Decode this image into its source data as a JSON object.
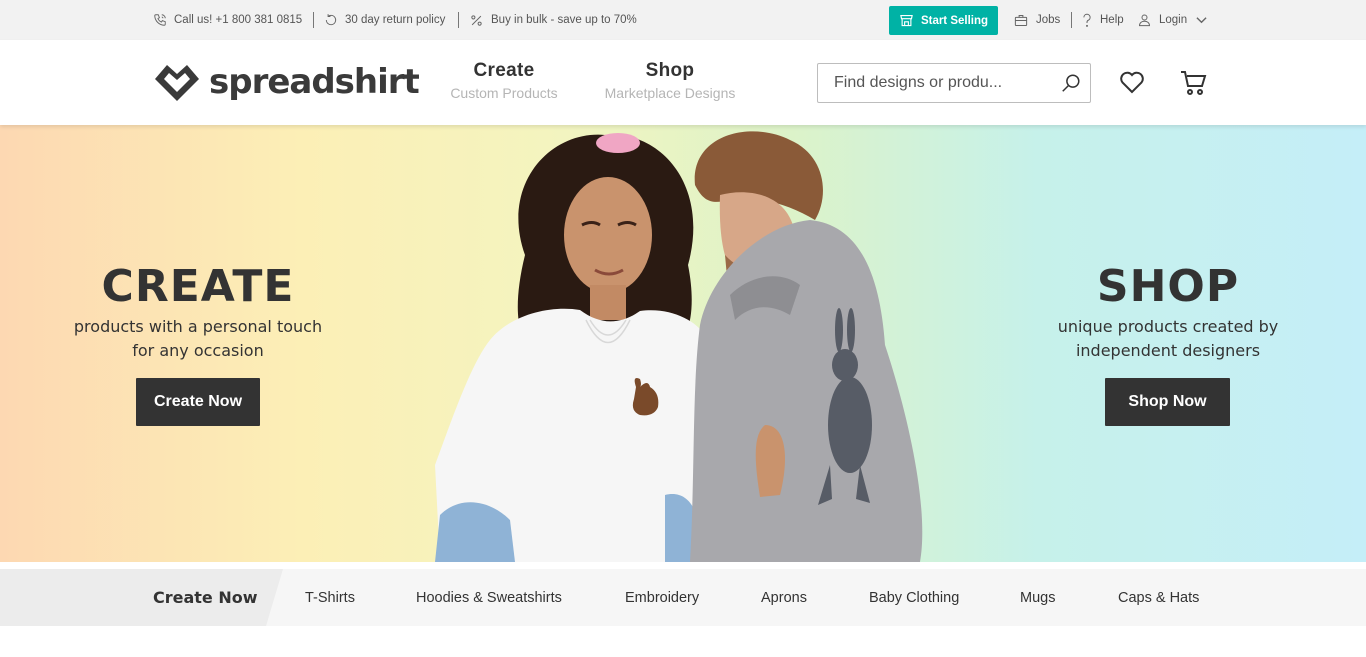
{
  "topbar": {
    "call_label": "Call us! +1 800 381 0815",
    "return_label": "30 day return policy",
    "bulk_label": "Buy in bulk - save up to 70%",
    "start_selling_label": "Start Selling",
    "jobs_label": "Jobs",
    "help_label": "Help",
    "login_label": "Login"
  },
  "header": {
    "logo_text": "spreadshirt",
    "nav": [
      {
        "label": "Create",
        "sub": "Custom Products"
      },
      {
        "label": "Shop",
        "sub": "Marketplace Designs"
      }
    ],
    "search_placeholder": "Find designs or produ..."
  },
  "hero": {
    "create_title": "CREATE",
    "create_sub_line1": "products with a personal touch",
    "create_sub_line2": "for any occasion",
    "create_button": "Create Now",
    "shop_title": "SHOP",
    "shop_sub_line1": "unique products created by",
    "shop_sub_line2": "independent designers",
    "shop_button": "Shop Now"
  },
  "categories": {
    "create_label": "Create Now",
    "items": [
      "T-Shirts",
      "Hoodies & Sweatshirts",
      "Embroidery",
      "Aprons",
      "Baby Clothing",
      "Mugs",
      "Caps & Hats"
    ]
  },
  "colors": {
    "accent": "#00b2a5",
    "dark_button": "#333333"
  },
  "icons": [
    "phone-icon",
    "return-icon",
    "percent-icon",
    "store-icon",
    "briefcase-icon",
    "question-icon",
    "user-icon",
    "chevron-down-icon",
    "search-icon",
    "heart-icon",
    "cart-icon"
  ]
}
